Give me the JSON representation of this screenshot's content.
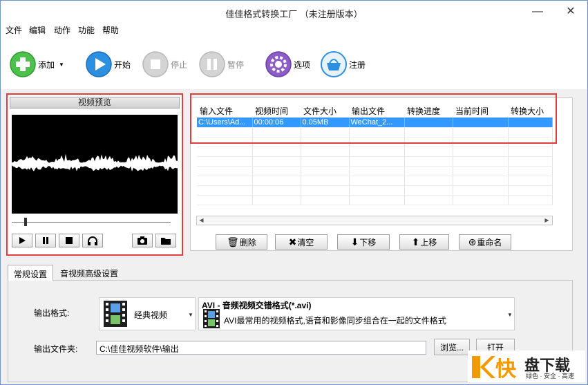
{
  "window": {
    "title": "佳佳格式转换工厂 （未注册版本）",
    "minimize_glyph": "—",
    "close_glyph": "✕"
  },
  "menu": [
    "文件",
    "编辑",
    "动作",
    "功能",
    "帮助"
  ],
  "toolbar": {
    "add": "添加",
    "start": "开始",
    "stop": "停止",
    "pause": "暂停",
    "options": "选项",
    "register": "注册",
    "colors": {
      "green": "#4cc14c",
      "blue": "#2d8fe0",
      "purple": "#8c5cc9",
      "disabled": "#c9c9c9"
    }
  },
  "preview": {
    "header": "视频预览",
    "seek_position": 0.08
  },
  "file_list": {
    "columns": [
      "输入文件",
      "视频时间",
      "文件大小",
      "输出文件",
      "转换进度",
      "当前时间",
      "转换大小"
    ],
    "rows": [
      [
        "C:\\Users\\Ad...",
        "00:00:06",
        "0.05MB",
        "WeChat_2...",
        "",
        "",
        ""
      ]
    ],
    "selection_color": "#3399ff",
    "buttons": {
      "delete": "删除",
      "clear": "清空",
      "move_down": "下移",
      "move_up": "上移",
      "rename": "重命名"
    }
  },
  "tabs": [
    "常规设置",
    "音视频高级设置"
  ],
  "settings": {
    "output_format_label": "输出格式:",
    "format_category": "经典视频",
    "format_title": "AVI - 音频视频交错格式(*.avi)",
    "format_desc": "AVI最常用的视频格式,语音和影像同步组合在一起的文件格式",
    "output_folder_label": "输出文件夹:",
    "output_folder_value": "C:\\佳佳视频软件\\输出",
    "browse": "浏览...",
    "open": "打开"
  },
  "watermark": {
    "logo_left": "K",
    "logo_right": "快",
    "name": "盘下载",
    "slogan": "绿色 · 安全 · 高速",
    "color": "#f39a00"
  },
  "highlight_color": "#e43d3d"
}
